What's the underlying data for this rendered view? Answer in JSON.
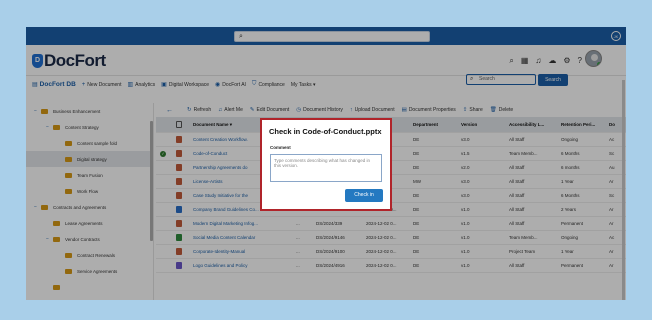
{
  "browser": {
    "search_placeholder": ""
  },
  "user_badge": "JK",
  "header": {
    "logo_mark": "D",
    "logo_text": "DocFort"
  },
  "nav": {
    "brand": "DocFort DB",
    "items": [
      "New Document",
      "Analytics",
      "Digital Workspace",
      "DocFort AI",
      "Compliance",
      "My Tasks ▾"
    ],
    "search_placeholder": "Search",
    "search_button": "Search"
  },
  "sidebar": {
    "nodes": [
      {
        "toggle": "−",
        "label": "Business Enhancement",
        "level": 0
      },
      {
        "toggle": "−",
        "label": "Content Strategy",
        "level": 1
      },
      {
        "toggle": "",
        "label": "Content sample fold",
        "level": 2
      },
      {
        "toggle": "",
        "label": "Digital strategy",
        "level": 2,
        "selected": true
      },
      {
        "toggle": "",
        "label": "Team Fusion",
        "level": 2
      },
      {
        "toggle": "",
        "label": "Work Flow",
        "level": 2
      },
      {
        "toggle": "−",
        "label": "Contracts and Agreements",
        "level": 0
      },
      {
        "toggle": "",
        "label": "Lease Agreements",
        "level": 1
      },
      {
        "toggle": "−",
        "label": "Vendor Contracts",
        "level": 1
      },
      {
        "toggle": "",
        "label": "Contract Renewals",
        "level": 2
      },
      {
        "toggle": "",
        "label": "Service Agreements",
        "level": 2
      },
      {
        "toggle": "",
        "label": "",
        "level": 1
      }
    ]
  },
  "toolbar": {
    "items": [
      "Refresh",
      "Alert Me",
      "Edit Document",
      "Document History",
      "Upload Document",
      "Document Properties",
      "Share",
      "Delete"
    ]
  },
  "grid": {
    "headers": [
      "Document Name ▾",
      "Modified",
      "Department",
      "Version",
      "Accessibility L...",
      "Retention Peri...",
      "Do"
    ],
    "rows": [
      {
        "name": "Content Creation Workflow.",
        "code": "",
        "date": "",
        "dept": "DE",
        "ver": "v3.0",
        "access": "All Staff",
        "ret": "Ongoing",
        "do": "Ac",
        "checked": false
      },
      {
        "name": "Code-of-Conduct",
        "code": "",
        "date": "",
        "dept": "DE",
        "ver": "v1.5",
        "access": "Team Memb...",
        "ret": "6 Months",
        "do": "Sc",
        "checked": true
      },
      {
        "name": "Partnership Agreements do",
        "code": "",
        "date": "",
        "dept": "DE",
        "ver": "v2.0",
        "access": "All Staff",
        "ret": "6 months",
        "do": "Au",
        "checked": false
      },
      {
        "name": "License-Artists",
        "code": "",
        "date": "",
        "dept": "MW",
        "ver": "v3.0",
        "access": "All Staff",
        "ret": "1 Year",
        "do": "Ar",
        "checked": false
      },
      {
        "name": "Case Study Initiative for the",
        "code": "",
        "date": "",
        "dept": "DE",
        "ver": "v3.0",
        "access": "All Staff",
        "ret": "6 Months",
        "do": "Sc",
        "checked": false
      },
      {
        "name": "Company Brand Guidelines Co...",
        "code": "DS/2024/775...",
        "date": "2024-12-02 0...",
        "dept": "DE",
        "ver": "v1.0",
        "access": "All Staff",
        "ret": "2 Years",
        "do": "Ar",
        "checked": false
      },
      {
        "name": "Modern Digital Marketing Infog...",
        "code": "DS/2024/339",
        "date": "2024-12-02 0...",
        "dept": "DE",
        "ver": "v1.0",
        "access": "All Staff",
        "ret": "Permanent",
        "do": "Ar",
        "checked": false
      },
      {
        "name": "Social Media Content Calendar",
        "code": "DS/2024/9146",
        "date": "2024-12-02 0...",
        "dept": "DE",
        "ver": "v1.0",
        "access": "Team Memb...",
        "ret": "Ongoing",
        "do": "Ac",
        "checked": false
      },
      {
        "name": "Corporate-Identity-Manual",
        "code": "DS/2024/9100",
        "date": "2024-12-02 0...",
        "dept": "DE",
        "ver": "v1.0",
        "access": "Project Team",
        "ret": "1 Year",
        "do": "Ar",
        "checked": false
      },
      {
        "name": "Logo Guidelines and Policy",
        "code": "DS/2024/4916",
        "date": "2024-12-02 0...",
        "dept": "DE",
        "ver": "v1.0",
        "access": "All Staff",
        "ret": "Permanent",
        "do": "Ar",
        "checked": false
      }
    ]
  },
  "dialog": {
    "title": "Check in Code-of-Conduct.pptx",
    "comment_label": "Comment",
    "comment_placeholder": "Type comments describing what has changed in this version.",
    "checkin_button": "Check in"
  },
  "colors": {
    "brand": "#1b5fa8",
    "dialog_border": "#b0242a",
    "folder": "#d89a16",
    "primary_button": "#2479c1"
  }
}
